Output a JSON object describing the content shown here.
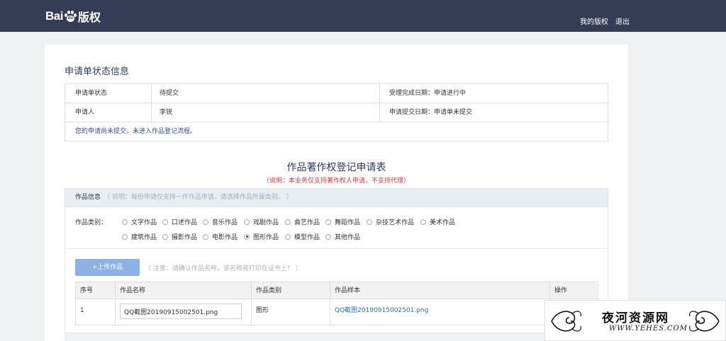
{
  "header": {
    "logo_bai": "Bai",
    "logo_du": "du",
    "logo_brand": "版权",
    "nav": {
      "my_copyright": "我的版权",
      "logout": "退出"
    }
  },
  "status": {
    "section_title": "申请单状态信息",
    "row1": {
      "label": "申请单状态",
      "value": "待提交",
      "right": "受理完成日期：申请进行中"
    },
    "row2": {
      "label": "申请人",
      "value": "李锐",
      "right": "申请提交日期：申请单未提交"
    },
    "notice": "您的申请尚未提交，未进入作品登记流程。"
  },
  "form": {
    "title": "作品著作权登记申请表",
    "subtitle": "（说明：本业务仅支持著作权人申请，不支持代理）",
    "info_label": "作品信息",
    "info_hint": "（ 说明：每份申请仅支持一件作品申请，请选择作品所属类别。 ）",
    "category_label": "作品类别：",
    "categories": [
      {
        "label": "文字作品",
        "checked": false
      },
      {
        "label": "口述作品",
        "checked": false
      },
      {
        "label": "音乐作品",
        "checked": false
      },
      {
        "label": "戏剧作品",
        "checked": false
      },
      {
        "label": "曲艺作品",
        "checked": false
      },
      {
        "label": "舞蹈作品",
        "checked": false
      },
      {
        "label": "杂技艺术作品",
        "checked": false
      },
      {
        "label": "美术作品",
        "checked": false
      },
      {
        "label": "建筑作品",
        "checked": false
      },
      {
        "label": "摄影作品",
        "checked": false
      },
      {
        "label": "电影作品",
        "checked": false
      },
      {
        "label": "图形作品",
        "checked": true
      },
      {
        "label": "模型作品",
        "checked": false
      },
      {
        "label": "其他作品",
        "checked": false
      }
    ],
    "upload_button": "+上传作品",
    "upload_hint": "（ 注意：请确认作品名称，该名称将打印在证书上！ ）",
    "table": {
      "headers": [
        "序号",
        "作品名称",
        "作品类别",
        "作品样本",
        "操作"
      ],
      "rows": [
        {
          "index": "1",
          "name": "QQ截图20190915002501.png",
          "category": "图形",
          "sample": "QQ截图20190915002501.png",
          "action": ""
        }
      ]
    }
  },
  "watermark": {
    "text": "夜河资源网",
    "url": "WWW.YEHES.COM"
  }
}
